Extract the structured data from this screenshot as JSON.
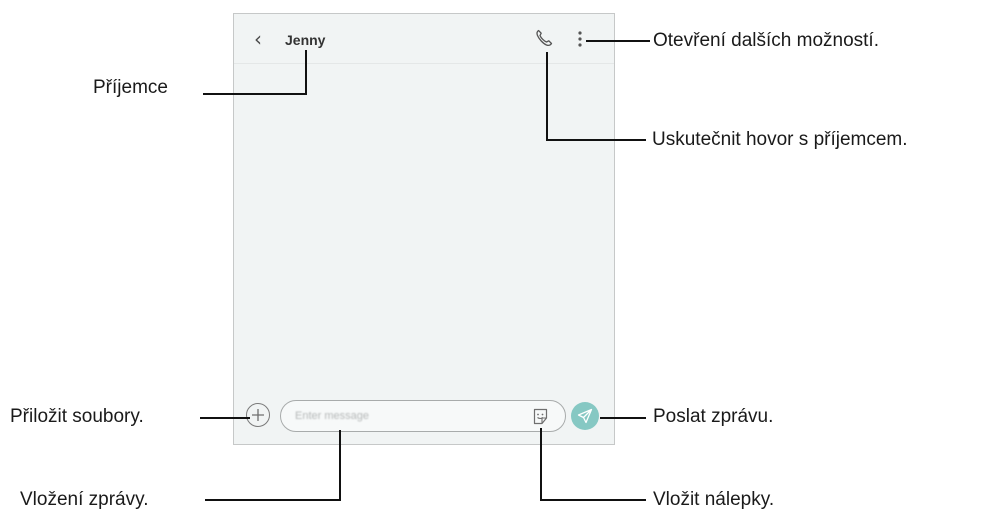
{
  "app": {
    "contact_name": "Jenny",
    "input_placeholder": "Enter message"
  },
  "icons": {
    "back": "chevron-left-icon",
    "call": "phone-icon",
    "more": "more-vertical-icon",
    "attach": "plus-icon",
    "sticker": "sticker-icon",
    "send": "send-icon"
  },
  "colors": {
    "screen_background": "#f1f4f4",
    "send_button": "#86c8c3",
    "leader_line": "#111111"
  },
  "callouts": {
    "recipient": "Příjemce",
    "more_options": "Otevření dalších možností.",
    "call_recipient": "Uskutečnit hovor s příjemcem.",
    "attach_files": "Přiložit soubory.",
    "send_message": "Poslat zprávu.",
    "enter_message": "Vložení zprávy.",
    "insert_stickers": "Vložit nálepky."
  }
}
